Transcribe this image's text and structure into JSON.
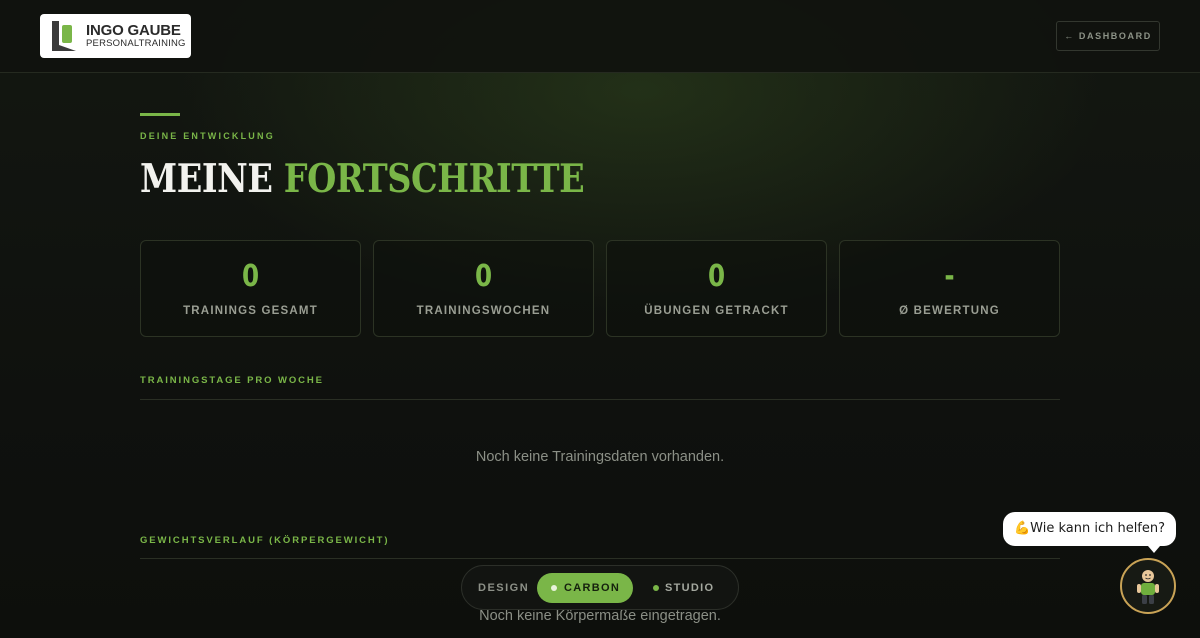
{
  "header": {
    "logo": {
      "name": "INGO GAUBE",
      "subtitle": "PERSONALTRAINING"
    },
    "dashboard_button": "← DASHBOARD"
  },
  "hero": {
    "eyebrow": "DEINE ENTWICKLUNG",
    "title_part1": "MEINE",
    "title_part2": "FORTSCHRITTE"
  },
  "stats": [
    {
      "value": "0",
      "label": "TRAININGS GESAMT"
    },
    {
      "value": "0",
      "label": "TRAININGSWOCHEN"
    },
    {
      "value": "0",
      "label": "ÜBUNGEN GETRACKT"
    },
    {
      "value": "-",
      "label": "Ø BEWERTUNG"
    }
  ],
  "sections": [
    {
      "title": "TRAININGSTAGE PRO WOCHE",
      "empty_message": "Noch keine Trainingsdaten vorhanden."
    },
    {
      "title": "GEWICHTSVERLAUF (KÖRPERGEWICHT)",
      "empty_message": "Noch keine Körpermaße eingetragen."
    }
  ],
  "design_switcher": {
    "label": "DESIGN",
    "options": [
      {
        "label": "CARBON",
        "active": true
      },
      {
        "label": "STUDIO",
        "active": false
      }
    ]
  },
  "chat": {
    "bubble_text": "💪Wie kann ich helfen?",
    "avatar_icon": "trainer-avatar-icon"
  },
  "colors": {
    "accent": "#7ab648",
    "background": "#0e100d",
    "avatar_ring": "#c9a356"
  }
}
